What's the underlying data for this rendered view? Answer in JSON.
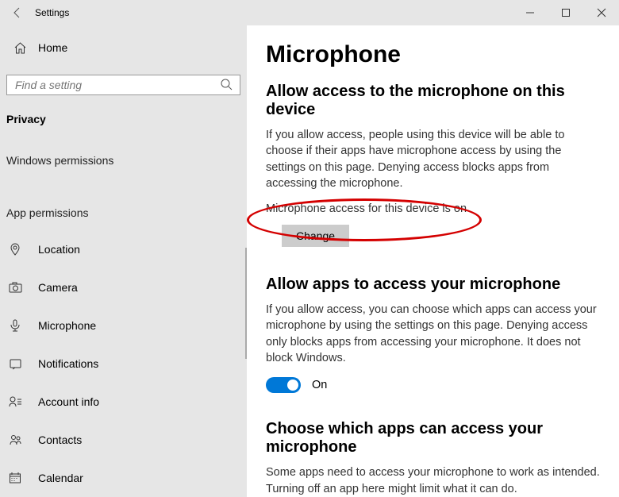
{
  "window": {
    "title": "Settings"
  },
  "sidebar": {
    "home": "Home",
    "search_placeholder": "Find a setting",
    "privacy_header": "Privacy",
    "win_perm_header": "Windows permissions",
    "app_perm_header": "App permissions",
    "perms": {
      "location": "Location",
      "camera": "Camera",
      "microphone": "Microphone",
      "notifications": "Notifications",
      "account": "Account info",
      "contacts": "Contacts",
      "calendar": "Calendar"
    }
  },
  "content": {
    "title": "Microphone",
    "s1": {
      "heading": "Allow access to the microphone on this device",
      "desc": "If you allow access, people using this device will be able to choose if their apps have microphone access by using the settings on this page. Denying access blocks apps from accessing the microphone.",
      "status": "Microphone access for this device is on",
      "change": "Change"
    },
    "s2": {
      "heading": "Allow apps to access your microphone",
      "desc": "If you allow access, you can choose which apps can access your microphone by using the settings on this page. Denying access only blocks apps from accessing your microphone. It does not block Windows.",
      "toggle_label": "On"
    },
    "s3": {
      "heading": "Choose which apps can access your microphone",
      "desc": "Some apps need to access your microphone to work as intended. Turning off an app here might limit what it can do."
    }
  }
}
